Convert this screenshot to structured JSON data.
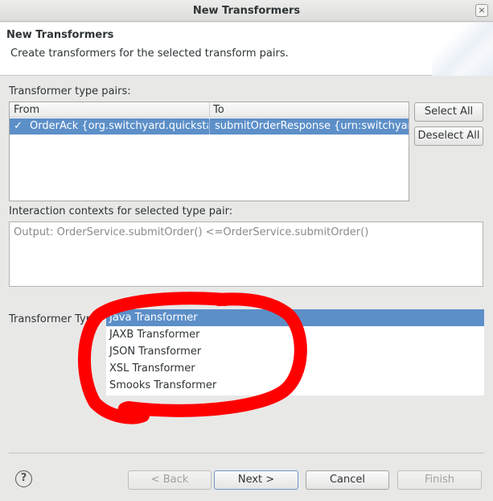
{
  "window": {
    "title": "New Transformers",
    "close_glyph": "×"
  },
  "banner": {
    "title": "New Transformers",
    "description": "Create transformers for the selected transform pairs."
  },
  "pairs": {
    "label": "Transformer type pairs:",
    "columns": {
      "from": "From",
      "to": "To"
    },
    "rows": [
      {
        "checked": true,
        "from": "OrderAck {org.switchyard.quickstart",
        "to": "submitOrderResponse {urn:switchyard"
      }
    ],
    "select_all": "Select All",
    "deselect_all": "Deselect All"
  },
  "contexts": {
    "label": "Interaction contexts for selected type pair:",
    "value": "Output: OrderService.submitOrder() <=OrderService.submitOrder()"
  },
  "transformer_type": {
    "label": "Transformer Type",
    "options": [
      "Java Transformer",
      "JAXB Transformer",
      "JSON Transformer",
      "XSL Transformer",
      "Smooks Transformer"
    ],
    "selected": "Java Transformer"
  },
  "footer": {
    "help_glyph": "?",
    "back": "< Back",
    "next": "Next >",
    "cancel": "Cancel",
    "finish": "Finish"
  },
  "colors": {
    "selection": "#5c8fc8",
    "annotation_marker": "#ff0000",
    "dialog_bg": "#e8e8e7"
  }
}
